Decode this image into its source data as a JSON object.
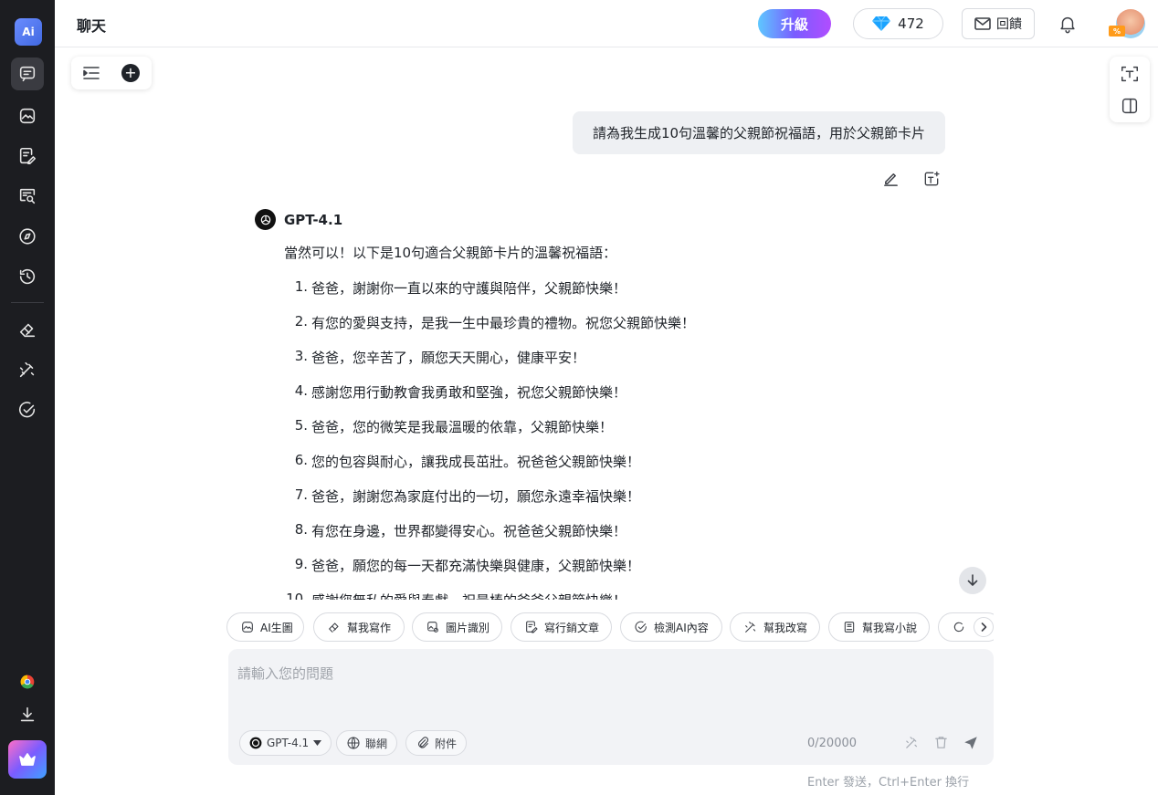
{
  "rail": {
    "logo_text": "Ai",
    "items": [
      "chat-icon",
      "image-icon",
      "write-icon",
      "search-doc-icon",
      "compass-icon",
      "history-icon",
      "eraser-icon",
      "magic-wand-icon",
      "check-circle-icon"
    ],
    "bottom": [
      "chrome-icon",
      "download-icon",
      "crown-icon"
    ]
  },
  "header": {
    "title": "聊天",
    "upgrade_label": "升級",
    "gems_count": "472",
    "feedback_label": "回饋",
    "avatar_badge": "%"
  },
  "conversation": {
    "user_message": "請為我生成10句溫馨的父親節祝福語，用於父親節卡片",
    "model_name": "GPT-4.1",
    "intro": "當然可以！以下是10句適合父親節卡片的溫馨祝福語：",
    "items": [
      {
        "n": "1.",
        "text": "爸爸，謝謝你一直以來的守護與陪伴，父親節快樂！"
      },
      {
        "n": "2.",
        "text": "有您的愛與支持，是我一生中最珍貴的禮物。祝您父親節快樂！"
      },
      {
        "n": "3.",
        "text": "爸爸，您辛苦了，願您天天開心，健康平安！"
      },
      {
        "n": "4.",
        "text": "感謝您用行動教會我勇敢和堅強，祝您父親節快樂！"
      },
      {
        "n": "5.",
        "text": "爸爸，您的微笑是我最溫暖的依靠，父親節快樂！"
      },
      {
        "n": "6.",
        "text": "您的包容與耐心，讓我成長茁壯。祝爸爸父親節快樂！"
      },
      {
        "n": "7.",
        "text": "爸爸，謝謝您為家庭付出的一切，願您永遠幸福快樂！"
      },
      {
        "n": "8.",
        "text": "有您在身邊，世界都變得安心。祝爸爸父親節快樂！"
      },
      {
        "n": "9.",
        "text": "爸爸，願您的每一天都充滿快樂與健康，父親節快樂！"
      },
      {
        "n": "10.",
        "text": "感謝您無私的愛與奉獻，祝最棒的爸爸父親節快樂！"
      }
    ]
  },
  "chips": [
    "AI生圖",
    "幫我寫作",
    "圖片識別",
    "寫行銷文章",
    "檢測AI內容",
    "幫我改寫",
    "幫我寫小說"
  ],
  "composer": {
    "placeholder": "請輸入您的問題",
    "model": "GPT-4.1",
    "web_label": "聯網",
    "attach_label": "附件",
    "counter": "0/20000",
    "hint": "Enter 發送，Ctrl+Enter 換行"
  }
}
